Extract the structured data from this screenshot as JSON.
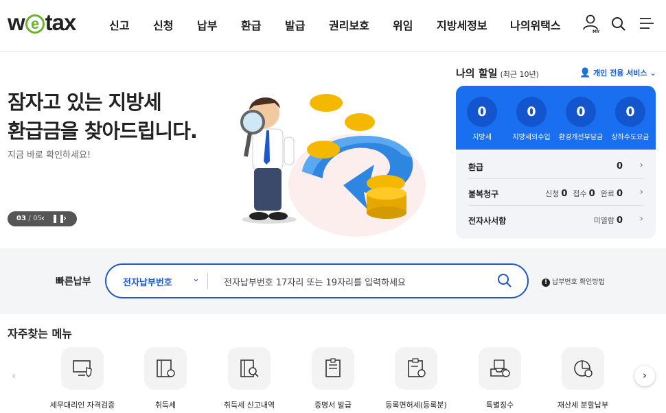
{
  "header": {
    "logo_pre": "w",
    "logo_e": "e",
    "logo_post": "tax",
    "nav": [
      "신고",
      "신청",
      "납부",
      "환급",
      "발급",
      "권리보호",
      "위임",
      "지방세정보",
      "나의위택스"
    ],
    "my_label": "MY",
    "icons": [
      "user-my-icon",
      "search-icon",
      "menu-icon"
    ]
  },
  "hero": {
    "title_line1": "잠자고 있는 지방세",
    "title_line2": "환급금을 찾아드립니다.",
    "subtitle": "지금 바로 확인하세요!",
    "page_current": "03",
    "page_separator": "/",
    "page_total": "05"
  },
  "discount": {
    "title": "나의 할일",
    "period": "(최근 10년)",
    "personal_service": "개인 전용 서비스",
    "stats": [
      {
        "value": "0",
        "label": "지방세"
      },
      {
        "value": "0",
        "label": "지방세외수입"
      },
      {
        "value": "0",
        "label": "환경개선부담금"
      },
      {
        "value": "0",
        "label": "상하수도요금"
      }
    ],
    "rows": {
      "refund": {
        "title": "환급",
        "value": "0"
      },
      "complaint": {
        "title": "불복청구",
        "apply_label": "신청",
        "apply": "0",
        "accept_label": "접수",
        "accept": "0",
        "done_label": "완료",
        "done": "0"
      },
      "mailbox": {
        "title": "전자사서함",
        "unread_label": "미열람",
        "unread": "0"
      }
    }
  },
  "quick_pay": {
    "label": "빠른납부",
    "select_value": "전자납부번호",
    "placeholder": "전자납부번호 17자리 또는 19자리를 입력하세요",
    "help": "납부번호 확인방법",
    "help_mark": "!"
  },
  "frequent": {
    "title": "자주찾는 메뉴",
    "items": [
      {
        "label": "세무대리인 자격검증",
        "icon": "monitor-shield-icon"
      },
      {
        "label": "취득세",
        "icon": "building-tax-icon"
      },
      {
        "label": "취득세 신고내역",
        "icon": "document-search-icon"
      },
      {
        "label": "증명서 발급",
        "icon": "certificate-icon"
      },
      {
        "label": "등록면허세(등록분)",
        "icon": "clipboard-tax-icon"
      },
      {
        "label": "특별징수",
        "icon": "tray-check-icon"
      },
      {
        "label": "재산세 분할납부",
        "icon": "pie-chart-icon"
      }
    ]
  },
  "colors": {
    "brand_blue": "#1a6ff0",
    "dark_blue": "#1d57c8",
    "logo_green": "#6bb22e"
  }
}
